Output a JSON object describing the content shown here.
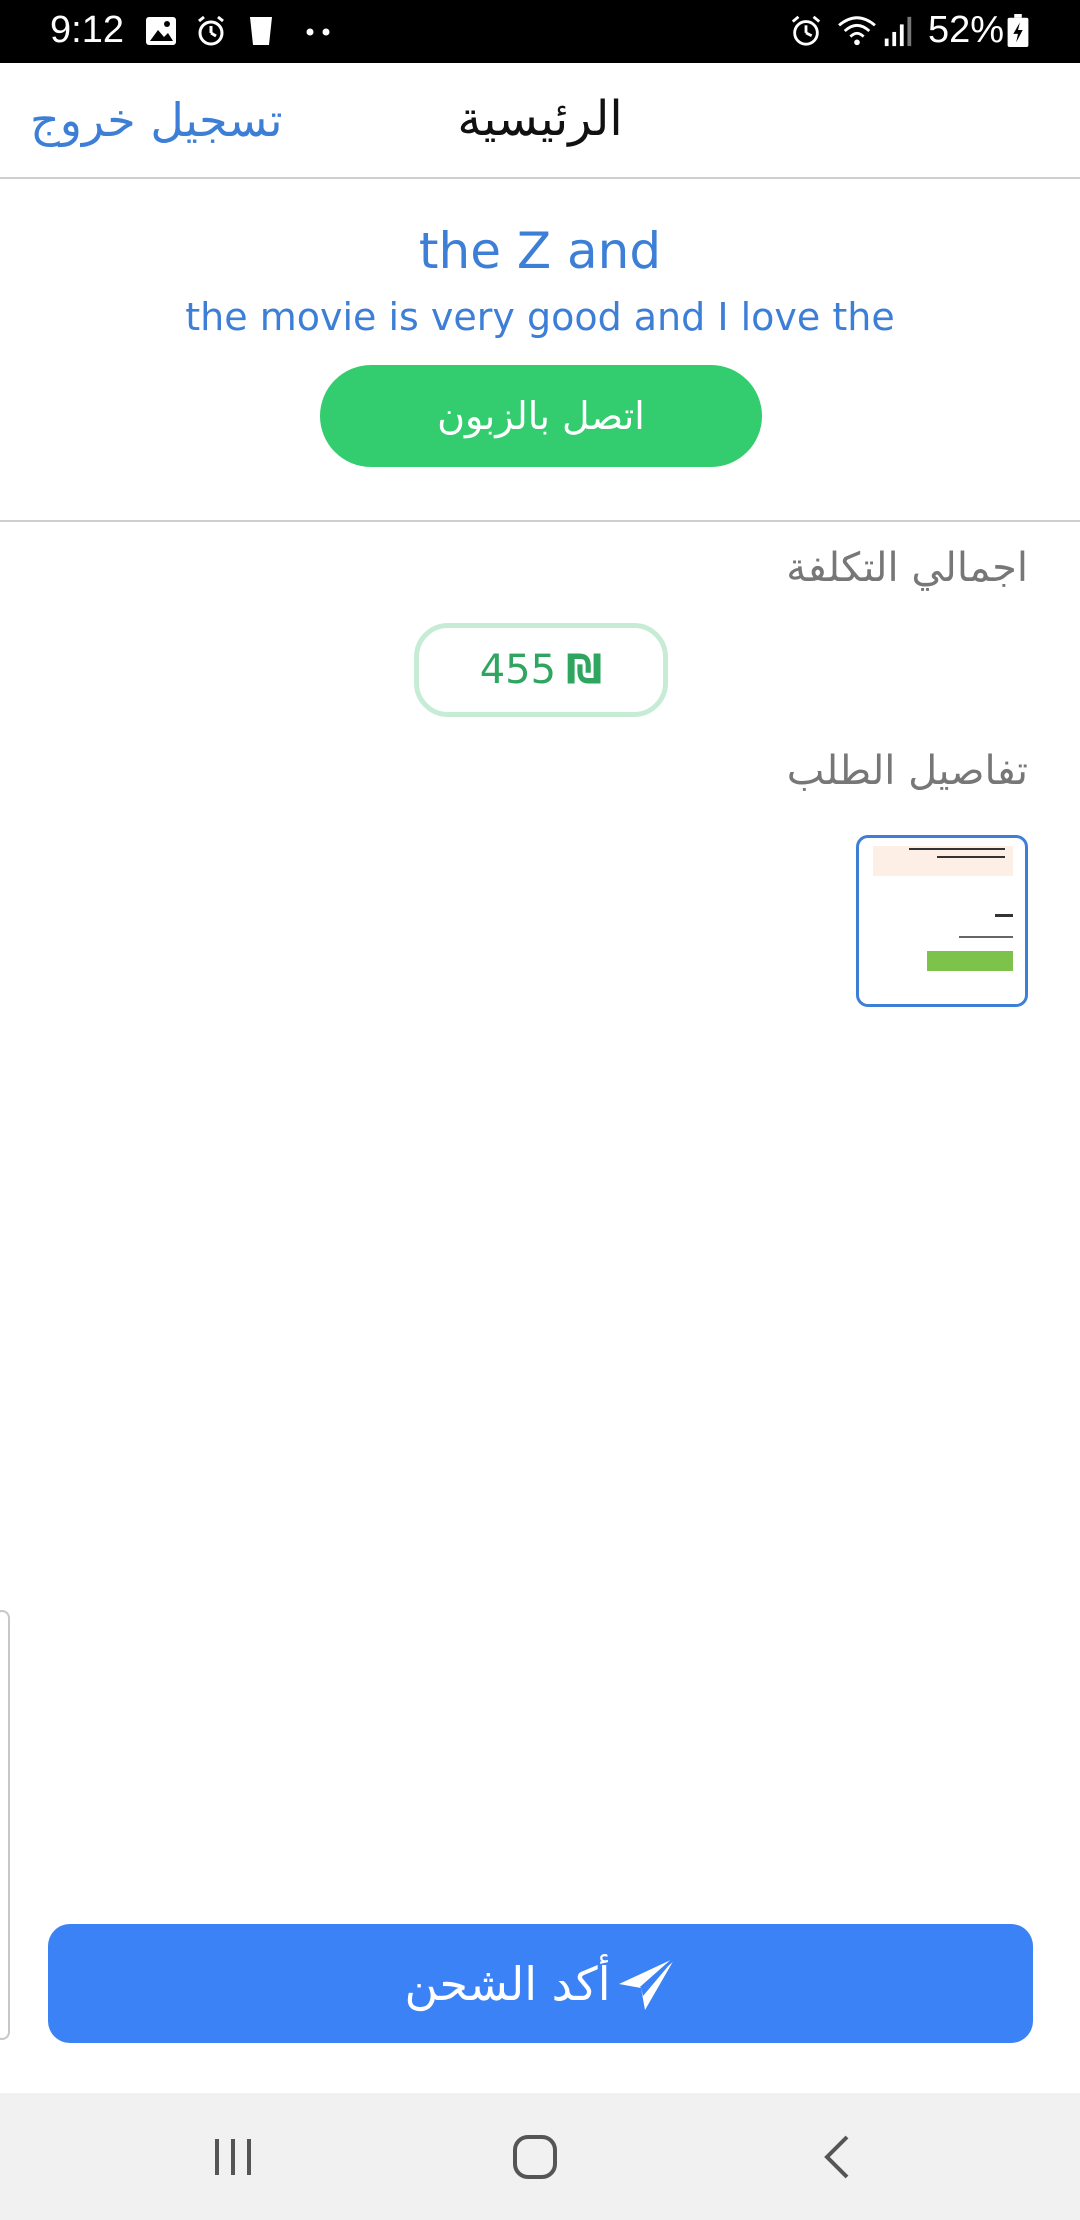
{
  "status_bar": {
    "time": "9:12",
    "battery": "52%",
    "icons": [
      "gallery-icon",
      "alarm-icon",
      "cup-icon",
      "more-dots-icon",
      "alarm-icon",
      "wifi-icon",
      "signal-icon",
      "battery-icon"
    ]
  },
  "header": {
    "title": "الرئيسية",
    "logout_label": "تسجيل خروج"
  },
  "customer": {
    "name": "the Z and",
    "description": "the movie is very good and I love the",
    "contact_label": "اتصل بالزبون"
  },
  "cost": {
    "label": "اجمالي التكلفة",
    "amount": "455",
    "currency_symbol": "₪"
  },
  "order": {
    "details_label": "تفاصيل الطلب"
  },
  "actions": {
    "confirm_label": "أكد الشحن"
  },
  "colors": {
    "accent_blue": "#3d7fd6",
    "confirm_blue": "#3b82f6",
    "contact_green": "#33cc6e",
    "amount_green": "#2ea660"
  }
}
